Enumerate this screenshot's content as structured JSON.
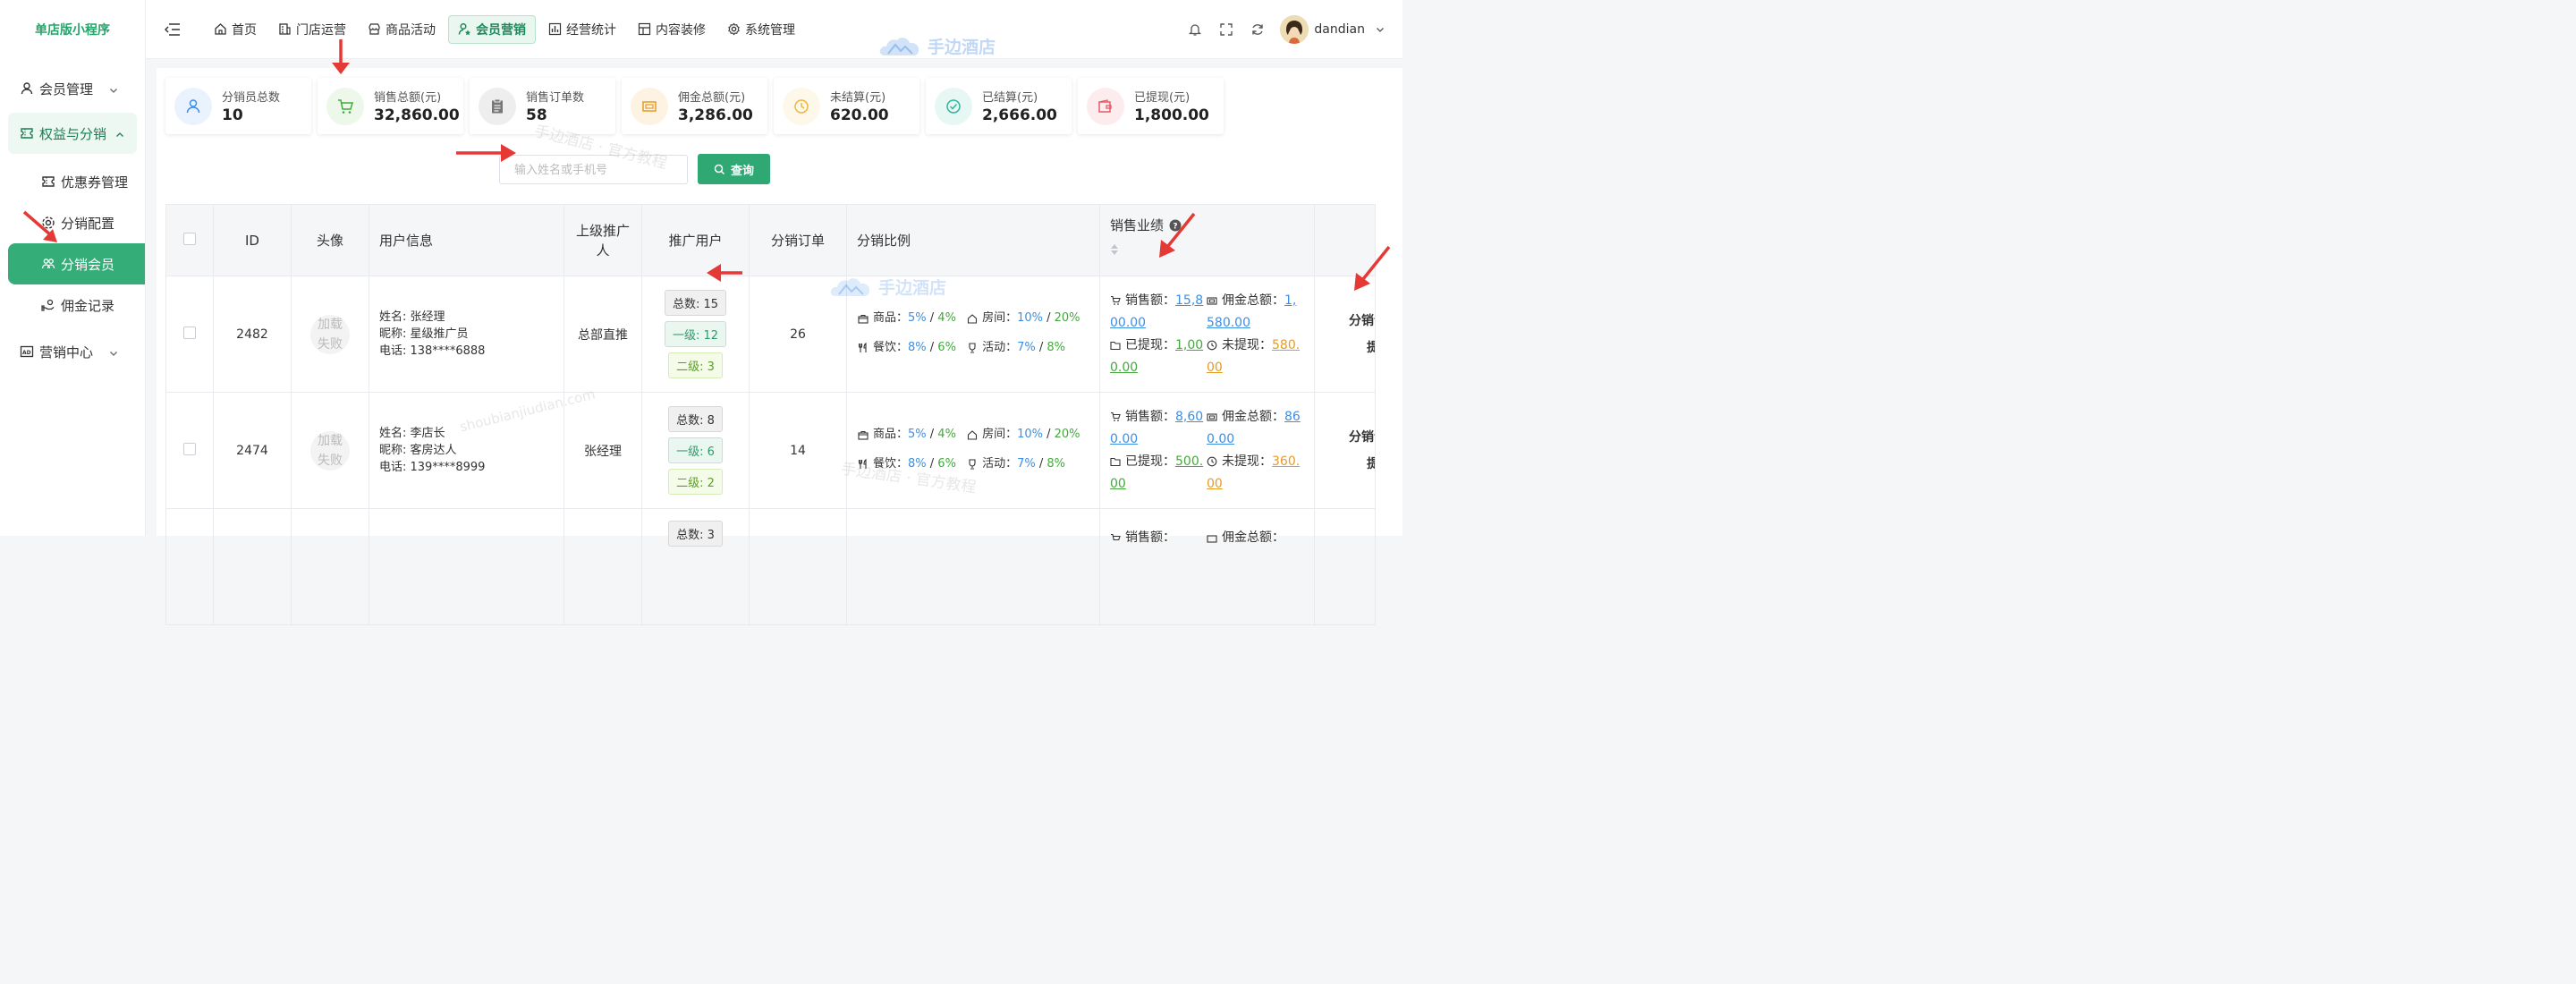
{
  "brand": "单店版小程序",
  "sidebar": {
    "items": [
      {
        "label": "会员管理",
        "icon": "user-icon",
        "expanded": false
      },
      {
        "label": "权益与分销",
        "icon": "ticket-icon",
        "expanded": true,
        "children": [
          {
            "label": "优惠券管理",
            "icon": "coupon-icon"
          },
          {
            "label": "分销配置",
            "icon": "settings-icon"
          },
          {
            "label": "分销会员",
            "icon": "users-icon",
            "active": true
          },
          {
            "label": "佣金记录",
            "icon": "hand-coin-icon"
          }
        ]
      },
      {
        "label": "营销中心",
        "icon": "ad-icon",
        "expanded": false
      }
    ]
  },
  "header": {
    "tabs": [
      {
        "label": "首页",
        "icon": "home-icon"
      },
      {
        "label": "门店运营",
        "icon": "building-icon"
      },
      {
        "label": "商品活动",
        "icon": "shop-icon"
      },
      {
        "label": "会员营销",
        "icon": "user-star-icon",
        "active": true
      },
      {
        "label": "经营统计",
        "icon": "bar-chart-icon"
      },
      {
        "label": "内容装修",
        "icon": "layout-icon"
      },
      {
        "label": "系统管理",
        "icon": "gear-icon"
      }
    ],
    "username": "dandian"
  },
  "stats": [
    {
      "label": "分销员总数",
      "value": "10",
      "icon": "user-icon",
      "color": "#3b8fe6",
      "bg": "#eaf3fd"
    },
    {
      "label": "销售总额(元)",
      "value": "32,860.00",
      "icon": "cart-icon",
      "color": "#43a93d",
      "bg": "#edf7ea"
    },
    {
      "label": "销售订单数",
      "value": "58",
      "icon": "clipboard-icon",
      "color": "#777777",
      "bg": "#eeeeee"
    },
    {
      "label": "佣金总额(元)",
      "value": "3,286.00",
      "icon": "money-icon",
      "color": "#e69b25",
      "bg": "#fdf3e3"
    },
    {
      "label": "未结算(元)",
      "value": "620.00",
      "icon": "clock-icon",
      "color": "#f0b53a",
      "bg": "#fef8ea"
    },
    {
      "label": "已结算(元)",
      "value": "2,666.00",
      "icon": "check-circle-icon",
      "color": "#2fb59b",
      "bg": "#e7f7f4"
    },
    {
      "label": "已提现(元)",
      "value": "1,800.00",
      "icon": "wallet-icon",
      "color": "#e25d6b",
      "bg": "#fdecee"
    }
  ],
  "search": {
    "placeholder": "输入姓名或手机号",
    "button": "查询"
  },
  "table": {
    "headers": {
      "id": "ID",
      "avatar": "头像",
      "user_info": "用户信息",
      "parent": "上级推广人",
      "promo_users": "推广用户",
      "orders": "分销订单",
      "ratio": "分销比例",
      "sales": "销售业绩"
    },
    "rows": [
      {
        "id": "2482",
        "avatar": "加载失败",
        "name": "姓名: 张经理",
        "nick": "昵称: 星级推广员",
        "phone": "电话: 138****6888",
        "parent": "总部直推",
        "total": "总数: 15",
        "lv1": "一级: 12",
        "lv2": "二级: 3",
        "orders": "26",
        "ratio": {
          "goods_label": "商品：",
          "goods_a": "5%",
          "goods_b": "4%",
          "room_label": "房间：",
          "room_a": "10%",
          "room_b": "20%",
          "food_label": "餐饮：",
          "food_a": "8%",
          "food_b": "6%",
          "event_label": "活动：",
          "event_a": "7%",
          "event_b": "8%"
        },
        "sales": {
          "sales_label": "销售额：",
          "sales_val": "15,8",
          "comm_label": "佣金总额：",
          "comm_val": "1,",
          "sales_val2": "00.00",
          "comm_val2": "580.00",
          "withdrawn_label": "已提现：",
          "withdrawn_val": "1,00",
          "pending_label": "未提现：",
          "pending_val": "580.",
          "withdrawn_val2": "0.00",
          "pending_val2": "00"
        },
        "op1": "分销订",
        "op2": "提"
      },
      {
        "id": "2474",
        "avatar": "加载失败",
        "name": "姓名: 李店长",
        "nick": "昵称: 客房达人",
        "phone": "电话: 139****8999",
        "parent": "张经理",
        "total": "总数: 8",
        "lv1": "一级: 6",
        "lv2": "二级: 2",
        "orders": "14",
        "ratio": {
          "goods_label": "商品：",
          "goods_a": "5%",
          "goods_b": "4%",
          "room_label": "房间：",
          "room_a": "10%",
          "room_b": "20%",
          "food_label": "餐饮：",
          "food_a": "8%",
          "food_b": "6%",
          "event_label": "活动：",
          "event_a": "7%",
          "event_b": "8%"
        },
        "sales": {
          "sales_label": "销售额：",
          "sales_val": "8,60",
          "comm_label": "佣金总额：",
          "comm_val": "86",
          "sales_val2": "0.00",
          "comm_val2": "0.00",
          "withdrawn_label": "已提现：",
          "withdrawn_val": "500.",
          "pending_label": "未提现：",
          "pending_val": "360.",
          "withdrawn_val2": "00",
          "pending_val2": "00"
        },
        "op1": "分销订",
        "op2": "提"
      },
      {
        "total": "总数: 3",
        "sales_label": "销售额：",
        "comm_label": "佣金总额："
      }
    ]
  },
  "watermarks": {
    "brand": "手边酒店",
    "tutorial": "手边酒店 · 官方教程",
    "domain": "shoubianjiudian.com"
  },
  "colors": {
    "accent": "#2fa874",
    "link_blue": "#3b8fe6",
    "link_green": "#43a93d",
    "link_orange": "#e69b25",
    "arrow_red": "#e53935"
  }
}
